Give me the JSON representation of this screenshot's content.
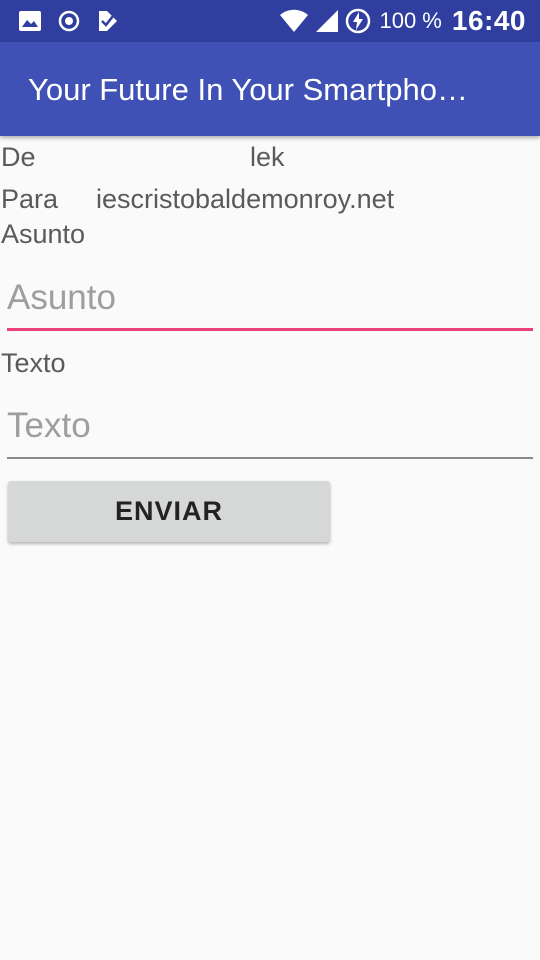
{
  "status_bar": {
    "left_icons": [
      "image-icon",
      "record-icon",
      "check-flag-icon"
    ],
    "right_icons": [
      "wifi-icon",
      "signal-icon",
      "battery-charging-icon"
    ],
    "battery": "100 %",
    "time": "16:40",
    "background": "#303f9f"
  },
  "app_bar": {
    "title": "Your Future In Your Smartpho…",
    "background": "#3f51b5"
  },
  "form": {
    "from_label": "De",
    "from_value": "lek",
    "to_label": "Para",
    "to_value": "iescristobaldemonroy.net",
    "subject_label": "Asunto",
    "subject_placeholder": "Asunto",
    "subject_value": "",
    "text_label": "Texto",
    "text_placeholder": "Texto",
    "text_value": "",
    "accent_color": "#ec407a"
  },
  "actions": {
    "send_label": "ENVIAR"
  }
}
